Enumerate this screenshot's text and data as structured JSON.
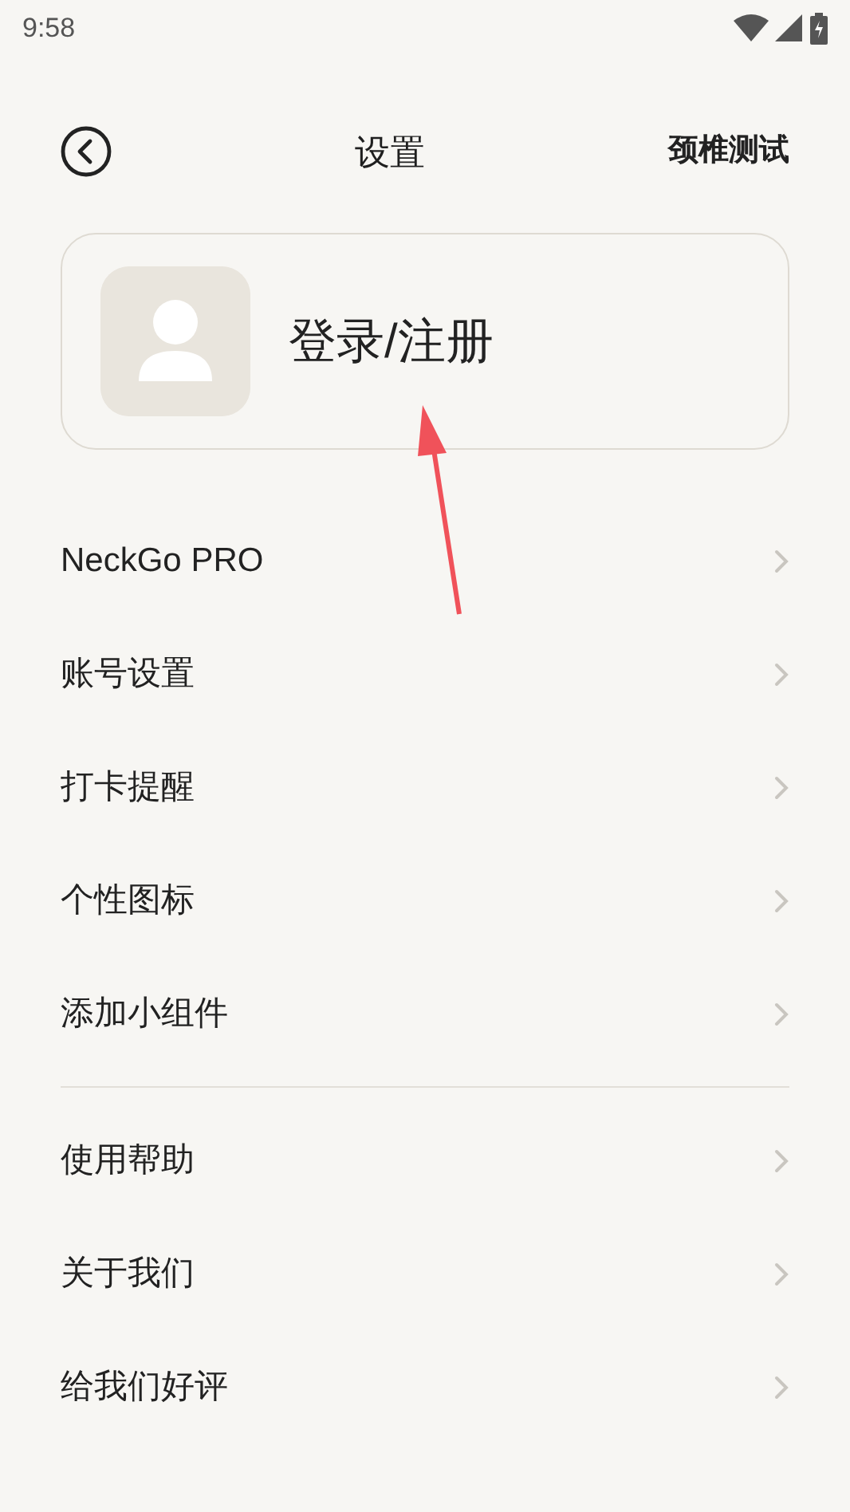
{
  "status_bar": {
    "time": "9:58"
  },
  "header": {
    "title": "设置",
    "action": "颈椎测试"
  },
  "login": {
    "label": "登录/注册"
  },
  "menu_groups": [
    {
      "items": [
        {
          "label": "NeckGo PRO"
        },
        {
          "label": "账号设置"
        },
        {
          "label": "打卡提醒"
        },
        {
          "label": "个性图标"
        },
        {
          "label": "添加小组件"
        }
      ]
    },
    {
      "items": [
        {
          "label": "使用帮助"
        },
        {
          "label": "关于我们"
        },
        {
          "label": "给我们好评"
        }
      ]
    }
  ]
}
